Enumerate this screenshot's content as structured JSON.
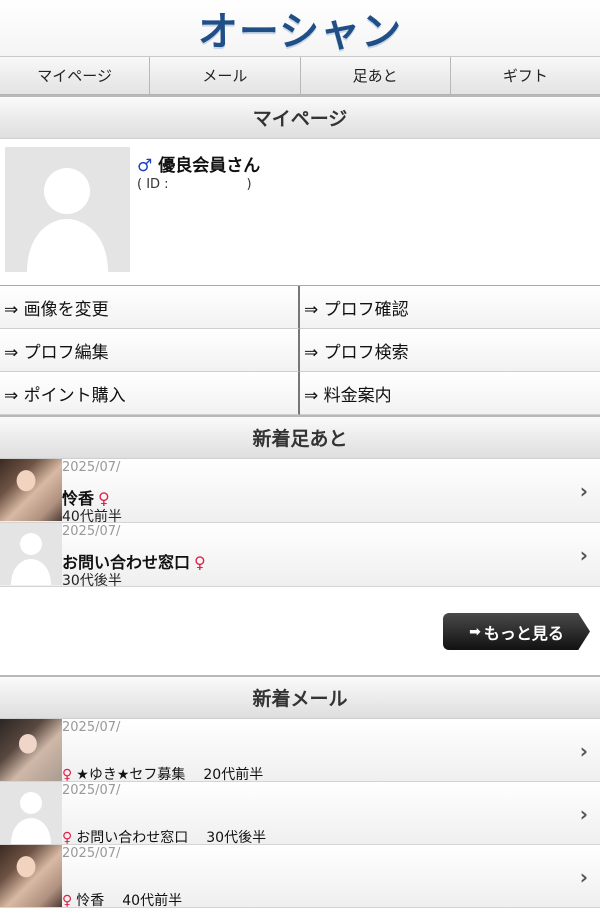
{
  "header": {
    "logo_text": "オーシャン"
  },
  "nav": {
    "items": [
      "マイページ",
      "メール",
      "足あと",
      "ギフト"
    ]
  },
  "mypage": {
    "section_title": "マイページ",
    "gender_symbol": "♂",
    "member_name": "優良会員さん",
    "id_label": "( ID :　　　　　　)",
    "menu": [
      "⇒ 画像を変更",
      "⇒ プロフ確認",
      "⇒ プロフ編集",
      "⇒ プロフ検索",
      "⇒ ポイント購入",
      "⇒ 料金案内"
    ]
  },
  "footprints": {
    "section_title": "新着足あと",
    "items": [
      {
        "date": "2025/07/",
        "name": "怜香",
        "gender_symbol": "♀",
        "age": "40代前半",
        "avatar": "photo"
      },
      {
        "date": "2025/07/",
        "name": "お問い合わせ窓口",
        "gender_symbol": "♀",
        "age": "30代後半",
        "avatar": "placeholder"
      }
    ],
    "more_label": "もっと見る",
    "more_icon": "➡"
  },
  "mail": {
    "section_title": "新着メール",
    "items": [
      {
        "date": "2025/07/",
        "gender_symbol": "♀",
        "name": "★ゆき★セフ募集",
        "age": "20代前半",
        "avatar": "photo"
      },
      {
        "date": "2025/07/",
        "gender_symbol": "♀",
        "name": "お問い合わせ窓口",
        "age": "30代後半",
        "avatar": "placeholder"
      },
      {
        "date": "2025/07/",
        "gender_symbol": "♀",
        "name": "怜香",
        "age": "40代前半",
        "avatar": "photo"
      }
    ]
  },
  "icons": {
    "chevron": "›"
  },
  "colors": {
    "brand": "#1f4f86",
    "male": "#1a3fc4",
    "female": "#e0224a"
  }
}
